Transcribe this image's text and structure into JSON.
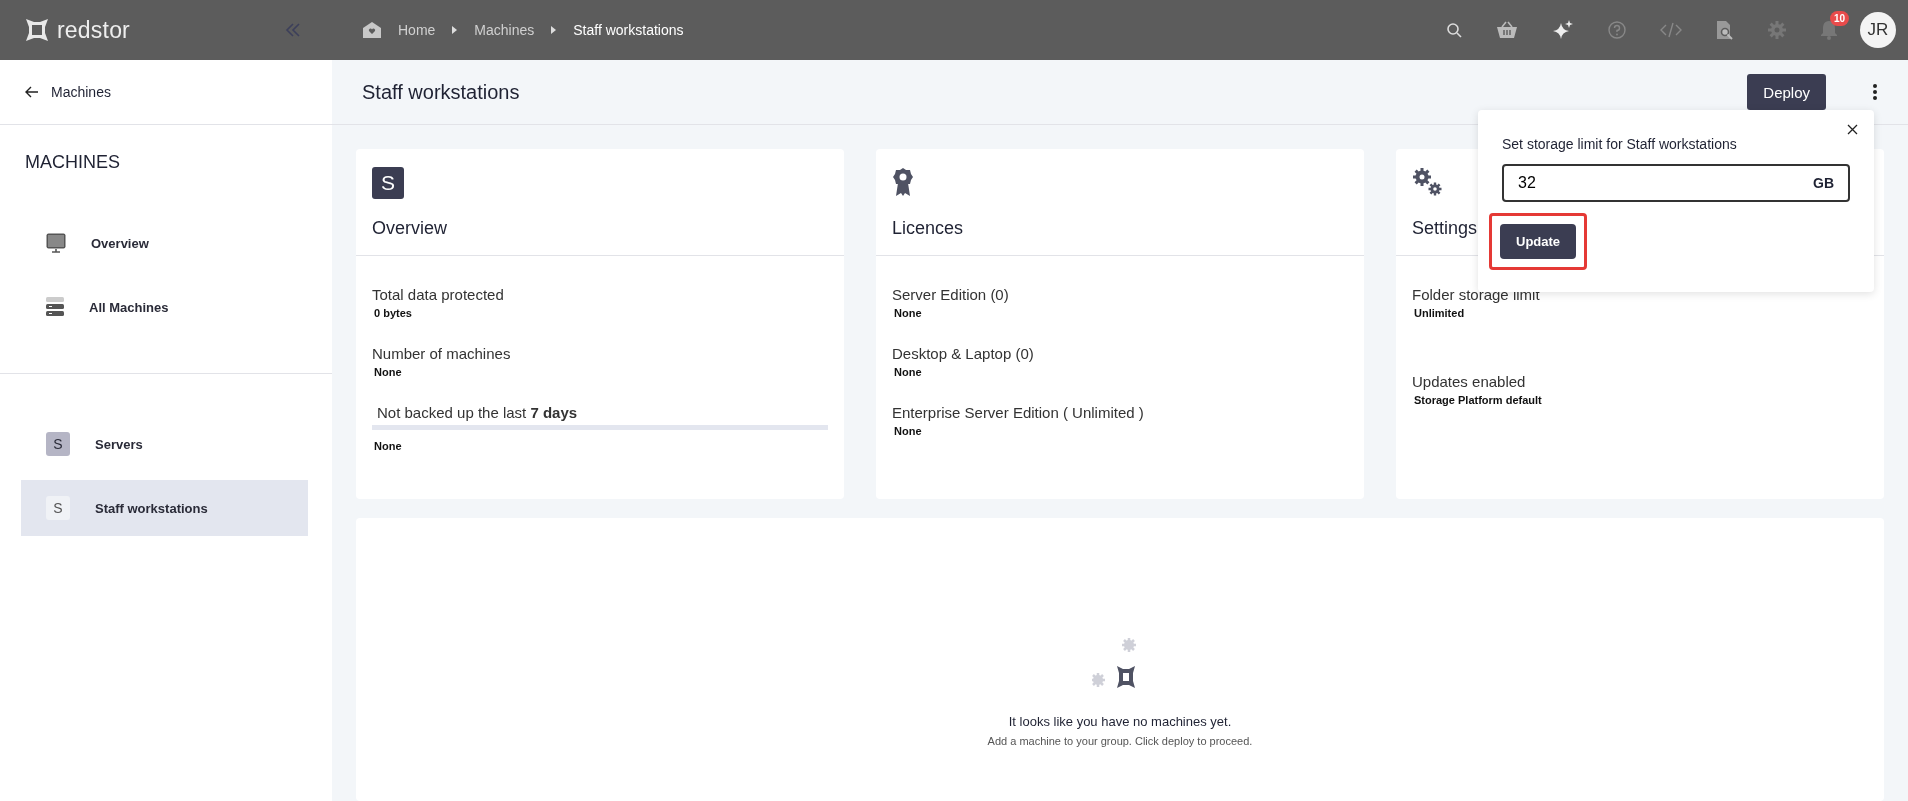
{
  "brand": "redstor",
  "breadcrumbs": [
    {
      "label": "Home",
      "selected": false
    },
    {
      "label": "Machines",
      "selected": false
    },
    {
      "label": "Staff workstations",
      "selected": true
    }
  ],
  "notifications": {
    "count": "10"
  },
  "avatar": "JR",
  "sidebar": {
    "back": "Machines",
    "heading": "MACHINES",
    "sections": [
      [
        {
          "label": "Overview",
          "kind": "monitor",
          "selected": false
        },
        {
          "label": "All Machines",
          "kind": "server",
          "selected": false
        }
      ],
      [
        {
          "label": "Servers",
          "kind": "letter",
          "letter": "S",
          "selected": false
        },
        {
          "label": "Staff workstations",
          "kind": "letter",
          "letter": "S",
          "selected": true
        }
      ]
    ]
  },
  "page": {
    "title": "Staff workstations",
    "deploy": "Deploy"
  },
  "cards": [
    {
      "kind": "letter",
      "letter": "S",
      "title": "Overview",
      "fields": [
        {
          "kind": "stat",
          "label": "Total data protected",
          "value": "0 bytes"
        },
        {
          "kind": "stat",
          "label": "Number of machines",
          "value": "None"
        },
        {
          "kind": "bar",
          "label": "Not backed up the last **7 days**",
          "value": "None"
        }
      ]
    },
    {
      "kind": "ribbon",
      "title": "Licences",
      "fields": [
        {
          "kind": "stat",
          "label": "Server Edition (0)",
          "value": "None"
        },
        {
          "kind": "stat",
          "label": "Desktop & Laptop (0)",
          "value": "None"
        },
        {
          "kind": "stat",
          "label": "Enterprise Server Edition ( Unlimited )",
          "value": "None"
        }
      ]
    },
    {
      "kind": "gears",
      "title": "Settings",
      "fields": [
        {
          "kind": "stat",
          "label": "Folder storage limit",
          "value": "Unlimited"
        },
        {
          "kind": "spaced",
          "label": "Updates enabled",
          "value": "Storage Platform default"
        }
      ]
    }
  ],
  "empty": {
    "message": "It looks like you have no machines yet.",
    "hint": "Add a machine to your group. Click deploy to proceed."
  },
  "popup": {
    "title": "Set storage limit for Staff workstations",
    "value": "32",
    "unit": "GB",
    "button": "Update",
    "highlighted": true
  }
}
